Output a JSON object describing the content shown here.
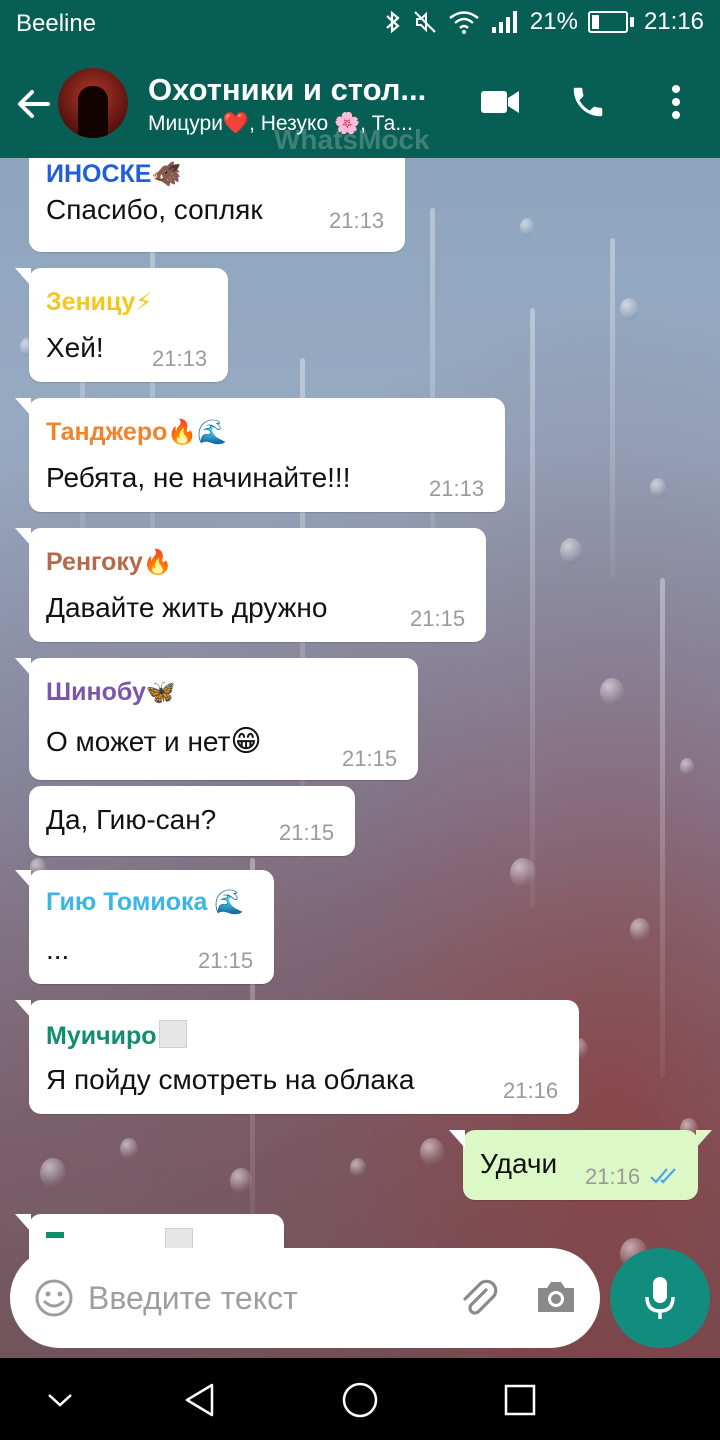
{
  "status_bar": {
    "carrier": "Beeline",
    "battery_percent": "21%",
    "battery_level": 0.21,
    "time": "21:16",
    "icons": [
      "bluetooth-icon",
      "mute-icon",
      "wifi-icon",
      "signal-icon",
      "battery-icon"
    ]
  },
  "header": {
    "title": "Охотники и стол...",
    "subtitle": "Мицури❤️, Незуко 🌸, Та...",
    "watermark": "WhatsMock",
    "icons": [
      "back-arrow-icon",
      "video-call-icon",
      "phone-icon",
      "more-vertical-icon"
    ]
  },
  "messages": [
    {
      "sender": "ИНОСКЕ",
      "sender_emoji": "🐗",
      "sender_color": "#1f5fd9",
      "text": "Спасибо, сопляк",
      "time": "21:13"
    },
    {
      "sender": "Зеницу",
      "sender_emoji": "⚡",
      "sender_color": "#f2c81f",
      "text": "Хей!",
      "time": "21:13"
    },
    {
      "sender": "Танджеро",
      "sender_emoji": "🔥🌊",
      "sender_color": "#f0842c",
      "text": "Ребята, не начинайте!!!",
      "time": "21:13"
    },
    {
      "sender": "Ренгоку",
      "sender_emoji": "🔥",
      "sender_color": "#b5694a",
      "text": "Давайте жить дружно",
      "time": "21:15"
    },
    {
      "sender": "Шинобу",
      "sender_emoji": "🦋",
      "sender_color": "#7b55ad",
      "text": "О может и нет",
      "text_emoji": "😁",
      "time": "21:15"
    },
    {
      "sender": "",
      "text": "Да, Гию-сан?",
      "time": "21:15"
    },
    {
      "sender": "Гию Томиока",
      "sender_emoji": "🌊",
      "sender_color": "#3bb5e6",
      "text": "...",
      "time": "21:15"
    },
    {
      "sender": "Муичиро",
      "sender_color": "#0f8f6e",
      "text": "Я пойду смотреть на облака",
      "time": "21:16"
    },
    {
      "outgoing": true,
      "text": "Удачи",
      "time": "21:16",
      "status_icon": "double-check-icon",
      "status_color": "#4fa3e8"
    }
  ],
  "input": {
    "placeholder": "Введите текст",
    "icons": [
      "emoji-icon",
      "attach-icon",
      "camera-icon",
      "mic-icon"
    ]
  },
  "colors": {
    "brand": "#075e54",
    "mic_button": "#128c7e",
    "outgoing_bubble": "#dcf8c6",
    "incoming_bubble": "#ffffff"
  },
  "nav_bar": {
    "icons": [
      "nav-down-icon",
      "nav-back-icon",
      "nav-home-icon",
      "nav-recents-icon"
    ]
  }
}
